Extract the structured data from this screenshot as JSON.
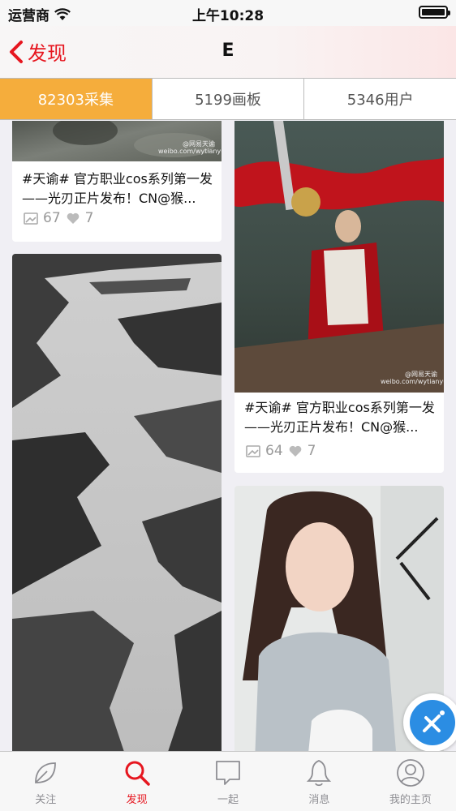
{
  "status_bar": {
    "carrier": "运营商",
    "time": "上午10:28"
  },
  "nav": {
    "back_label": "发现",
    "title": "E"
  },
  "segments": [
    {
      "label": "82303采集",
      "active": true
    },
    {
      "label": "5199画板",
      "active": false
    },
    {
      "label": "5346用户",
      "active": false
    }
  ],
  "cards": [
    {
      "text": "#天谕# 官方职业cos系列第一发——光刃正片发布！CN@猴...",
      "collects": "67",
      "likes": "7",
      "watermark": "@网易天谕 weibo.com/wytianyu"
    },
    {
      "text": "#天谕# 官方职业cos系列第一发——光刃正片发布！CN@猴...",
      "collects": "64",
      "likes": "7",
      "watermark": "@网易天谕 weibo.com/wytianyu"
    }
  ],
  "tabs": [
    {
      "label": "关注",
      "icon": "leaf-icon",
      "active": false
    },
    {
      "label": "发现",
      "icon": "search-icon",
      "active": true
    },
    {
      "label": "一起",
      "icon": "chat-bubble-icon",
      "active": false
    },
    {
      "label": "消息",
      "icon": "bell-icon",
      "active": false
    },
    {
      "label": "我的主页",
      "icon": "profile-icon",
      "active": false
    }
  ],
  "colors": {
    "accent_red": "#e6161f",
    "active_segment": "#f5ad3c",
    "fab_blue": "#2b8de3"
  }
}
